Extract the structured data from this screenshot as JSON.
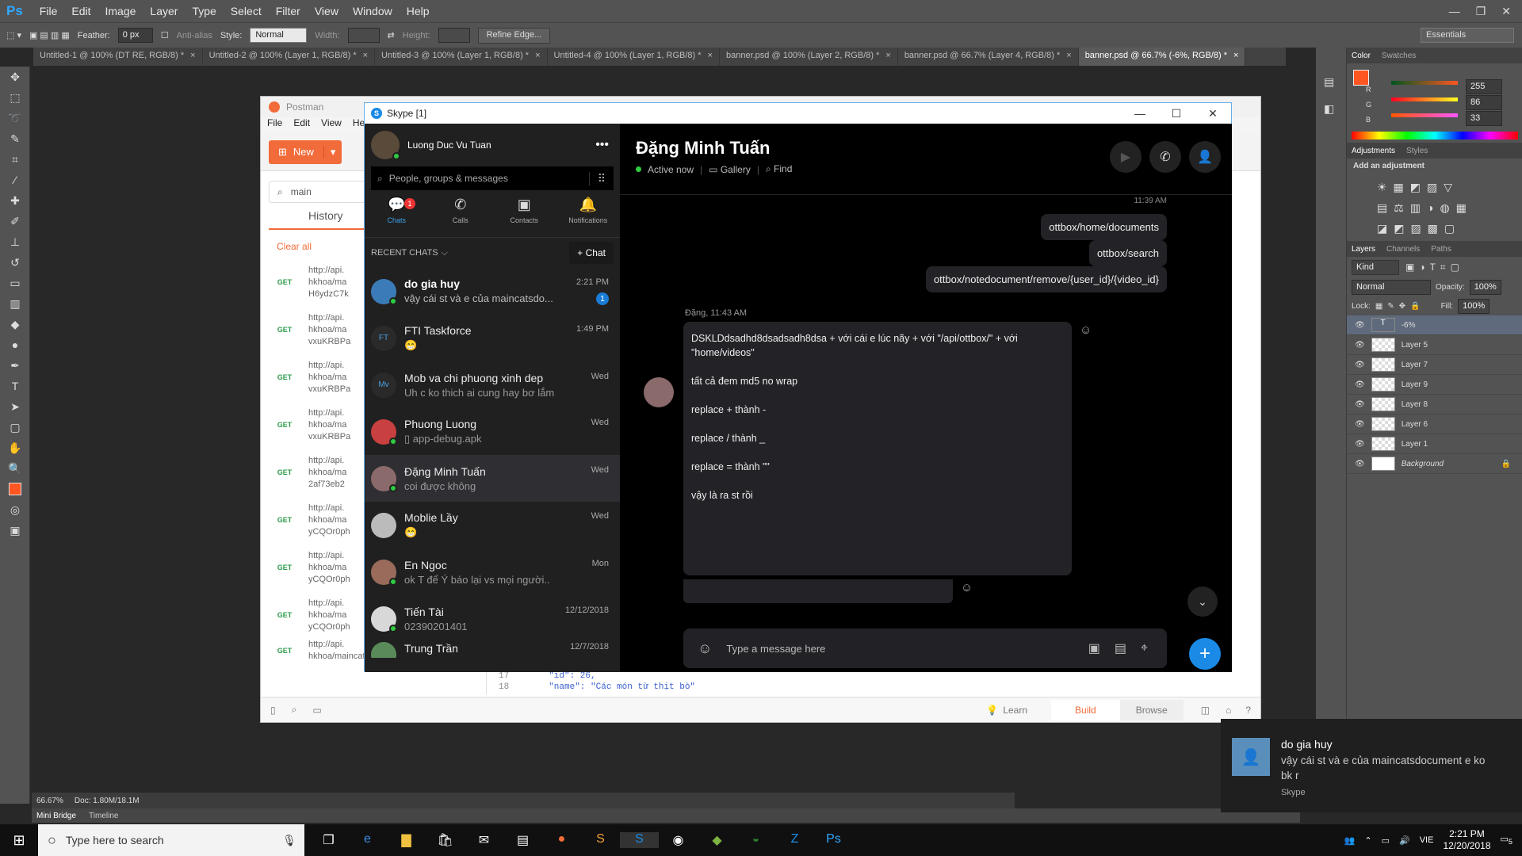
{
  "photoshop": {
    "logo": "Ps",
    "menu": [
      "File",
      "Edit",
      "Image",
      "Layer",
      "Type",
      "Select",
      "Filter",
      "View",
      "Window",
      "Help"
    ],
    "window_controls": [
      "—",
      "❐",
      "✕"
    ],
    "options": {
      "feather_label": "Feather:",
      "feather_value": "0 px",
      "antialias_label": "Anti-alias",
      "style_label": "Style:",
      "style_value": "Normal",
      "width_label": "Width:",
      "height_label": "Height:",
      "refine_edge": "Refine Edge...",
      "workspace": "Essentials"
    },
    "doc_tabs": [
      {
        "label": "Untitled-1 @ 100% (DT RE, RGB/8) *"
      },
      {
        "label": "Untitled-2 @ 100% (Layer 1, RGB/8) *"
      },
      {
        "label": "Untitled-3 @ 100% (Layer 1, RGB/8) *"
      },
      {
        "label": "Untitled-4 @ 100% (Layer 1, RGB/8) *"
      },
      {
        "label": "banner.psd @ 100% (Layer 2, RGB/8) *"
      },
      {
        "label": "banner.psd @ 66.7% (Layer 4, RGB/8) *"
      },
      {
        "label": "banner.psd @ 66.7% (-6%, RGB/8) *"
      }
    ],
    "status": {
      "zoom": "66.67%",
      "doc": "Doc: 1.80M/18.1M"
    },
    "bottom_tabs": [
      "Mini Bridge",
      "Timeline"
    ],
    "color_panel": {
      "tabs": [
        "Color",
        "Swatches"
      ],
      "r": "255",
      "g": "86",
      "b": "33",
      "fg": "#ff5621"
    },
    "adjustments": {
      "tabs": [
        "Adjustments",
        "Styles"
      ],
      "hint": "Add an adjustment"
    },
    "layers_panel": {
      "tabs": [
        "Layers",
        "Channels",
        "Paths"
      ],
      "kind": "Kind",
      "blend": "Normal",
      "opacity_label": "Opacity:",
      "opacity": "100%",
      "lock_label": "Lock:",
      "fill_label": "Fill:",
      "fill": "100%",
      "layers": [
        "-6%",
        "Layer 5",
        "Layer 7",
        "Layer 9",
        "Layer 8",
        "Layer 6",
        "Layer 1",
        "Background"
      ]
    }
  },
  "postman": {
    "title": "Postman",
    "menu": [
      "File",
      "Edit",
      "View",
      "Help"
    ],
    "new_button": "New",
    "search_value": "main",
    "history_tab": "History",
    "clear_all": "Clear all",
    "requests": [
      {
        "method": "GET",
        "lines": [
          "http://api.",
          "hkhoa/ma",
          "H6ydzC7k"
        ]
      },
      {
        "method": "GET",
        "lines": [
          "http://api.",
          "hkhoa/ma",
          "vxuKRBPa"
        ]
      },
      {
        "method": "GET",
        "lines": [
          "http://api.",
          "hkhoa/ma",
          "vxuKRBPa"
        ]
      },
      {
        "method": "GET",
        "lines": [
          "http://api.",
          "hkhoa/ma",
          "vxuKRBPa"
        ]
      },
      {
        "method": "GET",
        "lines": [
          "http://api.",
          "hkhoa/ma",
          "2af73eb2"
        ]
      },
      {
        "method": "GET",
        "lines": [
          "http://api.",
          "hkhoa/ma",
          "yCQOr0ph"
        ]
      },
      {
        "method": "GET",
        "lines": [
          "http://api.",
          "hkhoa/ma",
          "yCQOr0ph"
        ]
      },
      {
        "method": "GET",
        "lines": [
          "http://api.",
          "hkhoa/ma",
          "yCQOr0ph"
        ]
      },
      {
        "method": "GET",
        "lines": [
          "http://api.",
          "hkhoa/maincats",
          ""
        ]
      }
    ],
    "code_lines": [
      {
        "n": "17",
        "text": "\"id\": 26,"
      },
      {
        "n": "18",
        "text": "\"name\": \"Các món từ thịt bò\""
      }
    ],
    "footer": {
      "learn": "Learn",
      "build": "Build",
      "browse": "Browse"
    }
  },
  "skype": {
    "title": "Skype [1]",
    "profile_name": "Luong Duc Vu Tuan",
    "search_placeholder": "People, groups & messages",
    "nav": [
      {
        "label": "Chats",
        "badge": "1"
      },
      {
        "label": "Calls"
      },
      {
        "label": "Contacts"
      },
      {
        "label": "Notifications"
      }
    ],
    "recent_label": "RECENT CHATS",
    "new_chat": "Chat",
    "chats": [
      {
        "name": "do gia huy",
        "time": "2:21 PM",
        "preview": "vậy cái st và e của maincatsdo...",
        "unread": "1",
        "initials": "",
        "avatar_color": "#3b7bb8",
        "online": true
      },
      {
        "name": "FTI Taskforce",
        "time": "1:49 PM",
        "preview": "😁",
        "initials": "FT",
        "avatar_color": "#2a2a2a",
        "online": false
      },
      {
        "name": "Mob va chi phuong xinh dep",
        "time": "Wed",
        "preview": "Uh c ko thich ai cung hay bơ lắm",
        "initials": "Mv",
        "avatar_color": "#2a2a2a",
        "online": false
      },
      {
        "name": "Phuong Luong",
        "time": "Wed",
        "preview": "app-debug.apk",
        "initials": "",
        "avatar_color": "#c94040",
        "online": true
      },
      {
        "name": "Đặng Minh Tuấn",
        "time": "Wed",
        "preview": "coi được không",
        "initials": "",
        "avatar_color": "#8a6a6a",
        "online": true
      },
      {
        "name": "Moblie Lầy",
        "time": "Wed",
        "preview": "😁",
        "initials": "",
        "avatar_color": "#bbbbbb",
        "online": false
      },
      {
        "name": "En Ngoc",
        "time": "Mon",
        "preview": "ok T để Ý báo lại vs mọi người..",
        "initials": "",
        "avatar_color": "#9a6b5a",
        "online": true
      },
      {
        "name": "Tiến Tài",
        "time": "12/12/2018",
        "preview": "02390201401",
        "initials": "",
        "avatar_color": "#d8d8d8",
        "online": true
      },
      {
        "name": "Trung Trần",
        "time": "12/7/2018",
        "preview": "",
        "initials": "",
        "avatar_color": "#5a8a5a",
        "online": false
      }
    ],
    "conversation": {
      "name": "Đặng Minh Tuấn",
      "status": "Active now",
      "gallery": "Gallery",
      "find": "Find",
      "partial_time": "11:39 AM",
      "out_messages": [
        "ottbox/home/documents",
        "ottbox/search",
        "ottbox/notedocument/remove/{user_id}/{video_id}"
      ],
      "in_header": "Đặng, 11:43 AM",
      "in_lines": [
        "DSKLDdsadhd8dsadsadh8dsa      + với cái e lúc nãy + với \"/api/ottbox/\" + với \"home/videos\"",
        "tất cả đem md5 no wrap",
        "replace + thành -",
        "replace / thành _",
        "replace = thành \"\"",
        "vậy là ra st rồi"
      ],
      "compose_placeholder": "Type a message here"
    }
  },
  "toast": {
    "name": "do gia huy",
    "message": "vậy cái st và e của maincatsdocument e ko bk r",
    "app": "Skype"
  },
  "taskbar": {
    "search_placeholder": "Type here to search",
    "lang": "VIE",
    "time": "2:21 PM",
    "date": "12/20/2018",
    "notif_count": "5"
  }
}
